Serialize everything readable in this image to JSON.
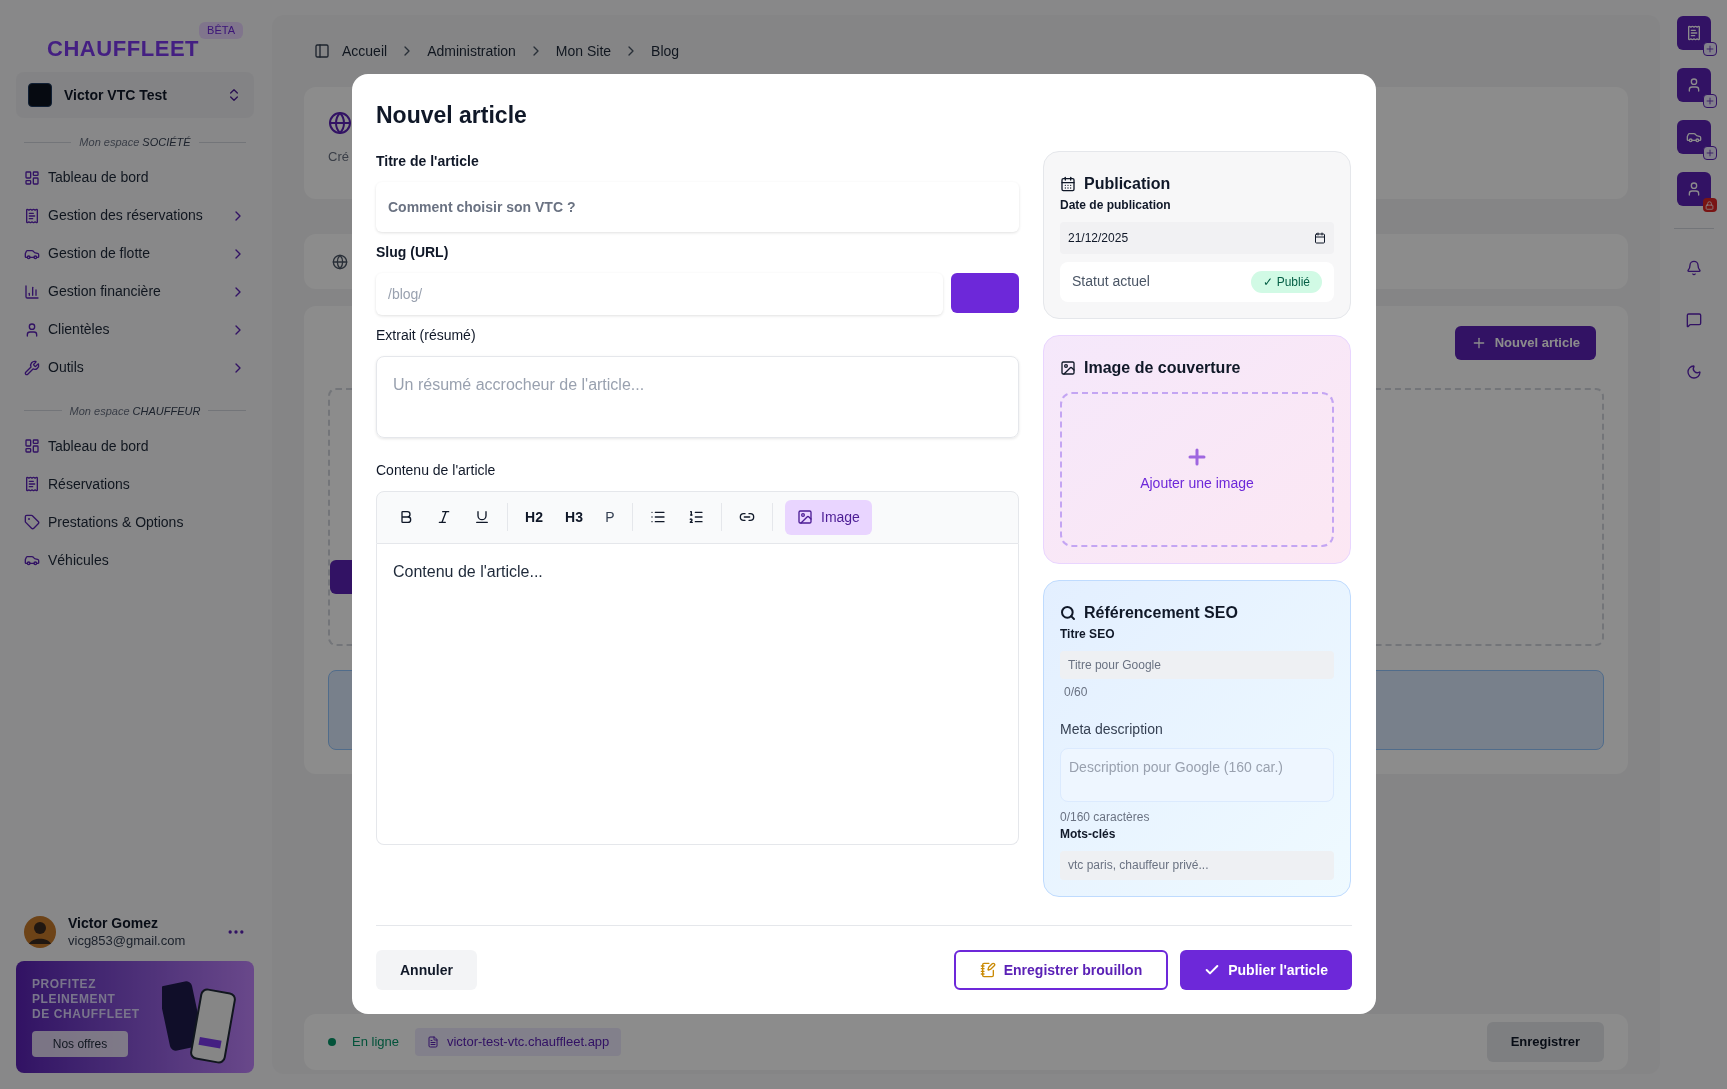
{
  "logo": {
    "text": "CHAUFFLEET",
    "badge": "BÊTA"
  },
  "workspace": {
    "name": "Victor VTC Test"
  },
  "sidebar": {
    "sections": [
      {
        "prefix": "Mon espace",
        "name": "SOCIÉTÉ",
        "items": [
          {
            "label": "Tableau de bord",
            "has_submenu": false
          },
          {
            "label": "Gestion des réservations",
            "has_submenu": true
          },
          {
            "label": "Gestion de flotte",
            "has_submenu": true
          },
          {
            "label": "Gestion financière",
            "has_submenu": true
          },
          {
            "label": "Clientèles",
            "has_submenu": true
          },
          {
            "label": "Outils",
            "has_submenu": true
          }
        ]
      },
      {
        "prefix": "Mon espace",
        "name": "CHAUFFEUR",
        "items": [
          {
            "label": "Tableau de bord",
            "has_submenu": false
          },
          {
            "label": "Réservations",
            "has_submenu": false
          },
          {
            "label": "Prestations & Options",
            "has_submenu": false
          },
          {
            "label": "Véhicules",
            "has_submenu": false
          }
        ]
      }
    ]
  },
  "user": {
    "name": "Victor Gomez",
    "email": "vicg853@gmail.com"
  },
  "promo": {
    "lines": [
      "PROFITEZ",
      "PLEINEMENT",
      "DE CHAUFFLEET"
    ],
    "button": "Nos offres"
  },
  "breadcrumb": [
    "Accueil",
    "Administration",
    "Mon Site",
    "Blog"
  ],
  "background": {
    "card_text": "Cré",
    "new_article_button": "Nouvel article",
    "status": "En ligne",
    "url": "victor-test-vtc.chauffleet.app",
    "save_button": "Enregistrer"
  },
  "modal": {
    "title": "Nouvel article",
    "title_field": {
      "label": "Titre de l'article",
      "placeholder": "Comment choisir son VTC ?"
    },
    "slug_field": {
      "label": "Slug (URL)",
      "placeholder": "/blog/"
    },
    "excerpt_field": {
      "label": "Extrait (résumé)",
      "placeholder": "Un résumé accrocheur de l'article..."
    },
    "content_field": {
      "label": "Contenu de l'article",
      "placeholder": "Contenu de l'article..."
    },
    "toolbar": [
      {
        "kind": "icon"
      },
      {
        "kind": "icon"
      },
      {
        "kind": "icon"
      },
      {
        "kind": "separator"
      },
      {
        "kind": "text",
        "label": "H2"
      },
      {
        "kind": "text",
        "label": "H3"
      },
      {
        "kind": "plain",
        "label": "P"
      },
      {
        "kind": "separator"
      },
      {
        "kind": "icon"
      },
      {
        "kind": "icon"
      },
      {
        "kind": "separator"
      },
      {
        "kind": "icon"
      },
      {
        "kind": "separator"
      },
      {
        "kind": "accent",
        "label": "Image"
      }
    ],
    "publication": {
      "title": "Publication",
      "date_label": "Date de publication",
      "date": "21/12/2025",
      "status_label": "Statut actuel",
      "status": "✓ Publié"
    },
    "cover": {
      "title": "Image de couverture",
      "action": "Ajouter une image"
    },
    "seo": {
      "title": "Référencement SEO",
      "seo_title_label": "Titre SEO",
      "seo_title_placeholder": "Titre pour Google",
      "seo_title_count": "0/60",
      "meta_label": "Meta description",
      "meta_placeholder": "Description pour Google (160 car.)",
      "meta_count": "0/160 caractères",
      "keywords_label": "Mots-clés",
      "keywords_placeholder": "vtc paris, chauffeur privé..."
    },
    "cancel_button": "Annuler",
    "draft_button": "Enregistrer brouillon",
    "publish_button": "Publier l'article"
  }
}
